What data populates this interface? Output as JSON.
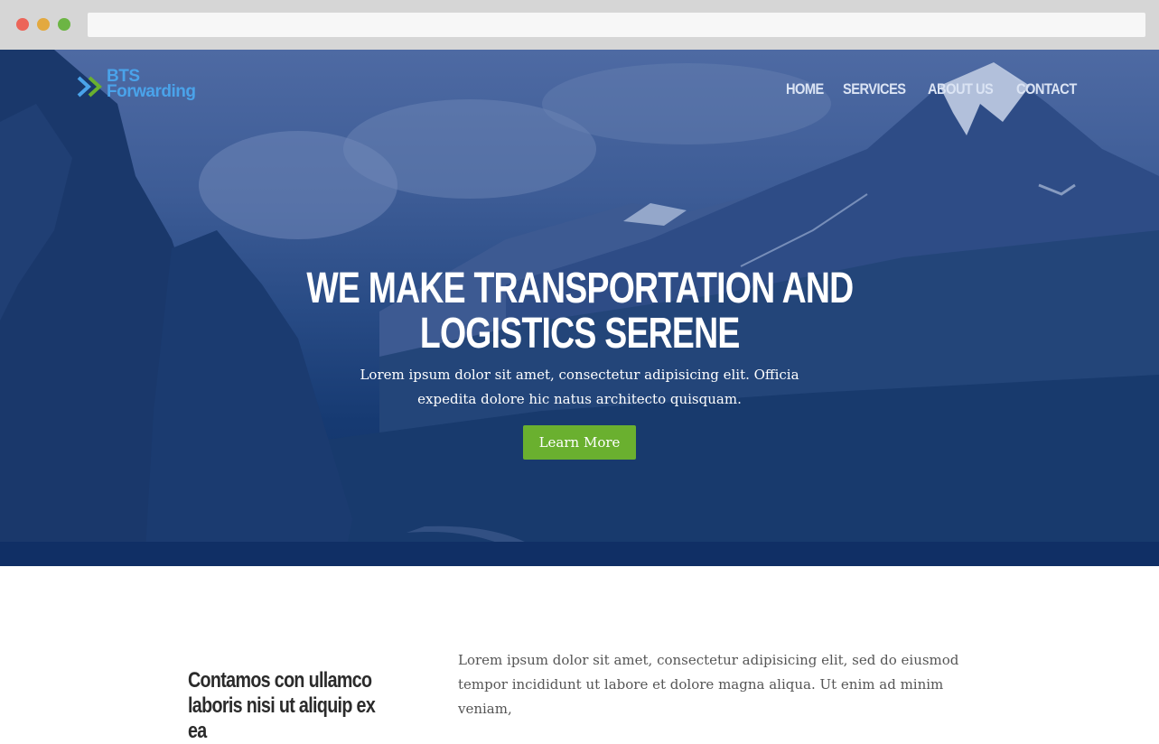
{
  "logo": {
    "line1": "BTS",
    "line2": "Forwarding"
  },
  "nav": {
    "items": [
      {
        "label": "HOME"
      },
      {
        "label": "SERVICES"
      },
      {
        "label": "ABOUT US"
      },
      {
        "label": "CONTACT"
      }
    ]
  },
  "hero": {
    "headline_line1": "WE MAKE TRANSPORTATION AND",
    "headline_line2": "LOGISTICS SERENE",
    "subtext": "Lorem ipsum dolor sit amet, consectetur adipisicing elit. Officia expedita dolore hic natus architecto quisquam.",
    "cta_label": "Learn More"
  },
  "intro": {
    "heading": "Contamos con ullamco laboris nisi ut aliquip ex ea",
    "body": "Lorem ipsum dolor sit amet, consectetur adipisicing elit, sed do eiusmod tempor incididunt ut labore et dolore magna aliqua. Ut enim ad minim veniam,"
  },
  "colors": {
    "accent_green": "#6ab02f",
    "logo_blue": "#4aa3ea",
    "overlay_blue": "#163a72"
  },
  "icons": [
    "logo-chevron-icon"
  ]
}
